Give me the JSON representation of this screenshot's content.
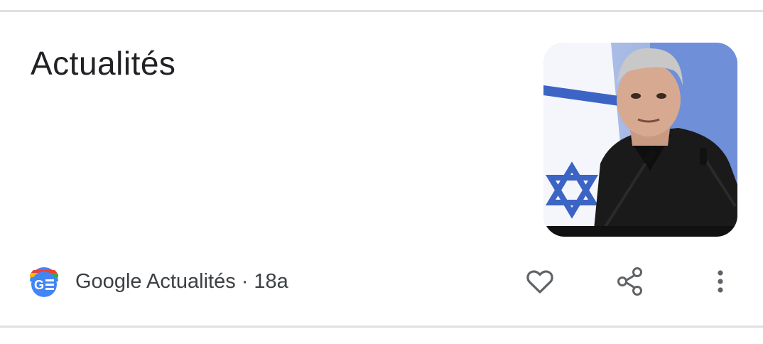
{
  "card": {
    "title": "Actualités",
    "thumbnail_icon": "news-photo-thumbnail",
    "source": {
      "name": "Google Actualités",
      "separator": "·",
      "age": "18a",
      "logo_icon": "google-news-icon"
    },
    "actions": {
      "like_icon": "heart-icon",
      "share_icon": "share-icon",
      "more_icon": "more-vert-icon"
    }
  },
  "colors": {
    "title": "#202124",
    "meta_text": "#3c4043",
    "icon": "#5f6368",
    "divider": "#e0e0e0",
    "google_blue": "#4285F4",
    "google_red": "#EA4335",
    "google_yellow": "#FBBC04",
    "google_green": "#34A853"
  }
}
